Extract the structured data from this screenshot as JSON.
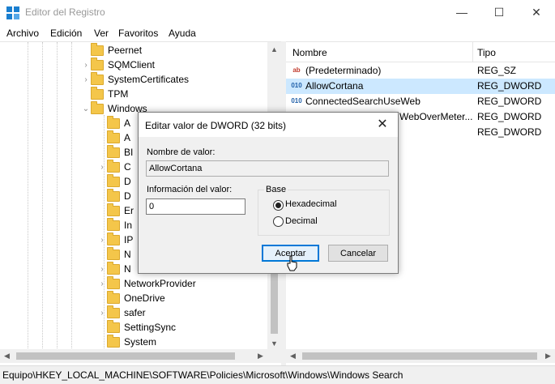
{
  "window": {
    "title": "Editor del Registro",
    "minimize": "—",
    "maximize": "☐",
    "close": "✕"
  },
  "menu": [
    "Archivo",
    "Edición",
    "Ver",
    "Favoritos",
    "Ayuda"
  ],
  "tree": {
    "items": [
      {
        "label": "Peernet",
        "expander": ""
      },
      {
        "label": "SQMClient",
        "expander": "›"
      },
      {
        "label": "SystemCertificates",
        "expander": "›"
      },
      {
        "label": "TPM",
        "expander": ""
      },
      {
        "label": "Windows",
        "expander": "⌄"
      }
    ],
    "children": [
      {
        "label": "A",
        "expander": ""
      },
      {
        "label": "A",
        "expander": ""
      },
      {
        "label": "BI",
        "expander": ""
      },
      {
        "label": "C",
        "expander": "›"
      },
      {
        "label": "D",
        "expander": ""
      },
      {
        "label": "D",
        "expander": ""
      },
      {
        "label": "Er",
        "expander": ""
      },
      {
        "label": "In",
        "expander": ""
      },
      {
        "label": "IP",
        "expander": "›"
      },
      {
        "label": "N",
        "expander": ""
      },
      {
        "label": "N",
        "expander": "›"
      },
      {
        "label": "NetworkProvider",
        "expander": "›"
      },
      {
        "label": "OneDrive",
        "expander": ""
      },
      {
        "label": "safer",
        "expander": "›"
      },
      {
        "label": "SettingSync",
        "expander": ""
      },
      {
        "label": "System",
        "expander": ""
      }
    ]
  },
  "list": {
    "columns": [
      "Nombre",
      "Tipo"
    ],
    "rows": [
      {
        "icon": "ab",
        "name": "(Predeterminado)",
        "type": "REG_SZ",
        "selected": false
      },
      {
        "icon": "010",
        "name": "AllowCortana",
        "type": "REG_DWORD",
        "selected": true
      },
      {
        "icon": "010",
        "name": "ConnectedSearchUseWeb",
        "type": "REG_DWORD",
        "selected": false
      },
      {
        "icon": "010",
        "name": "WebOverMeter...",
        "type": "REG_DWORD",
        "selected": false
      },
      {
        "icon": "010",
        "name": "",
        "type": "REG_DWORD",
        "selected": false
      }
    ]
  },
  "status": {
    "path": "Equipo\\HKEY_LOCAL_MACHINE\\SOFTWARE\\Policies\\Microsoft\\Windows\\Windows Search"
  },
  "dialog": {
    "title": "Editar valor de DWORD (32 bits)",
    "close": "✕",
    "name_label": "Nombre de valor:",
    "name_value": "AllowCortana",
    "data_label": "Información del valor:",
    "data_value": "0",
    "base_label": "Base",
    "hex_label": "Hexadecimal",
    "dec_label": "Decimal",
    "base_selected": "Hexadecimal",
    "ok_label": "Aceptar",
    "cancel_label": "Cancelar"
  },
  "colors": {
    "selection": "#cce8ff",
    "folder": "#f4c64a",
    "accent": "#0078d7"
  }
}
